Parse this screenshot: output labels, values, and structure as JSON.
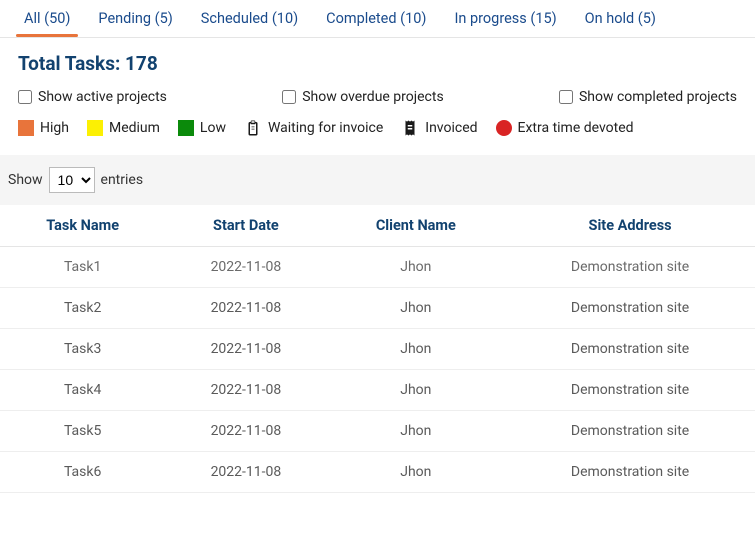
{
  "tabs": [
    {
      "label": "All (50)",
      "active": true
    },
    {
      "label": "Pending (5)",
      "active": false
    },
    {
      "label": "Scheduled (10)",
      "active": false
    },
    {
      "label": "Completed (10)",
      "active": false
    },
    {
      "label": "In progress (15)",
      "active": false
    },
    {
      "label": "On hold (5)",
      "active": false
    }
  ],
  "total_tasks": "Total Tasks: 178",
  "filters": {
    "active": "Show active projects",
    "overdue": "Show overdue projects",
    "completed": "Show completed projects"
  },
  "legend": {
    "high": "High",
    "medium": "Medium",
    "low": "Low",
    "waiting": "Waiting for invoice",
    "invoiced": "Invoiced",
    "extra": "Extra time devoted"
  },
  "colors": {
    "high": "#e8743b",
    "medium": "#fcf003",
    "low": "#0b8a0b",
    "extra": "#d92424"
  },
  "show_entries": {
    "show_label": "Show",
    "entries_label": "entries",
    "value": "10"
  },
  "table": {
    "headers": {
      "task_name": "Task Name",
      "start_date": "Start Date",
      "client_name": "Client Name",
      "site_address": "Site Address"
    },
    "rows": [
      {
        "task_name": "Task1",
        "start_date": "2022-11-08",
        "client_name": "Jhon",
        "site_address": "Demonstration site"
      },
      {
        "task_name": "Task2",
        "start_date": "2022-11-08",
        "client_name": "Jhon",
        "site_address": "Demonstration site"
      },
      {
        "task_name": "Task3",
        "start_date": "2022-11-08",
        "client_name": "Jhon",
        "site_address": "Demonstration site"
      },
      {
        "task_name": "Task4",
        "start_date": "2022-11-08",
        "client_name": "Jhon",
        "site_address": "Demonstration site"
      },
      {
        "task_name": "Task5",
        "start_date": "2022-11-08",
        "client_name": "Jhon",
        "site_address": "Demonstration site"
      },
      {
        "task_name": "Task6",
        "start_date": "2022-11-08",
        "client_name": "Jhon",
        "site_address": "Demonstration site"
      }
    ]
  }
}
